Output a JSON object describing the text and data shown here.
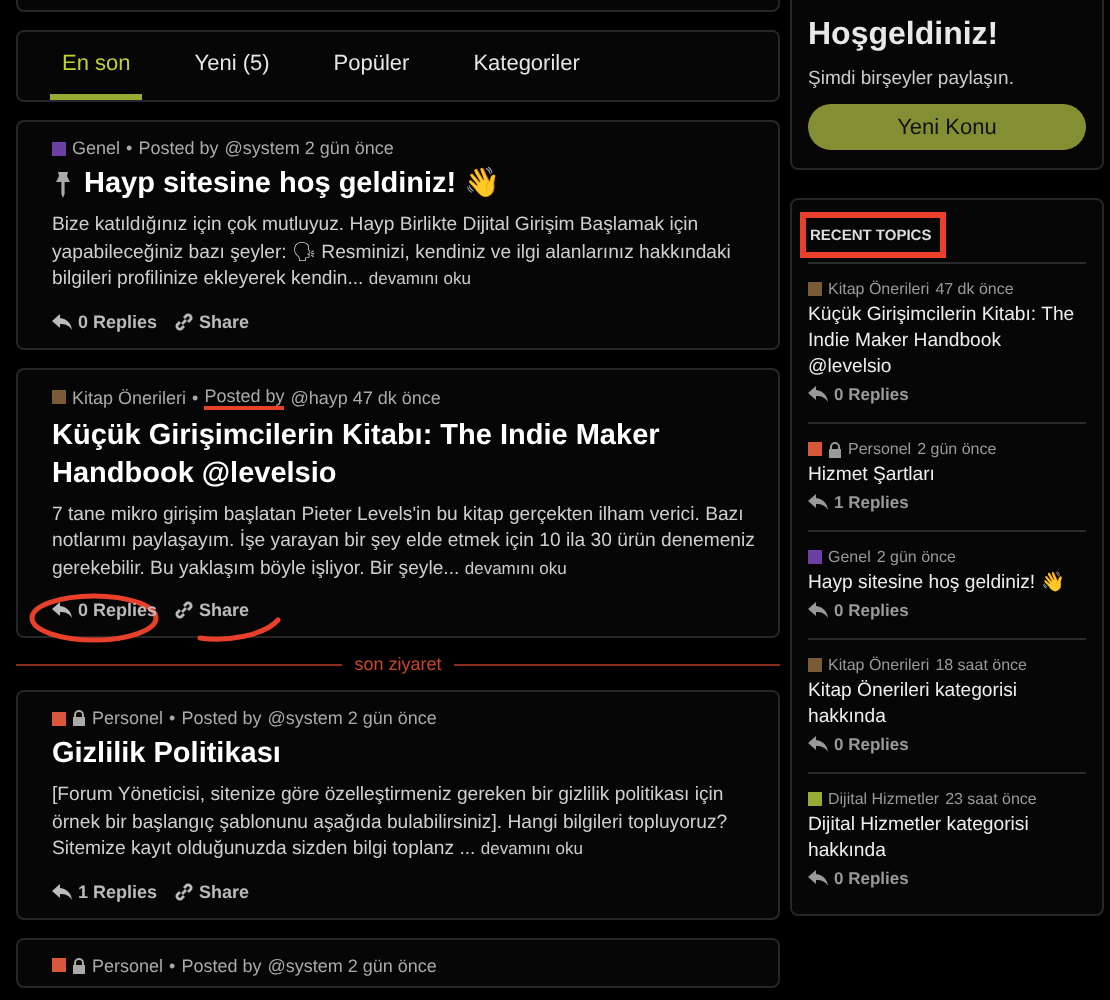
{
  "welcome": {
    "title": "Hoşgeldiniz!",
    "subtitle": "Şimdi birşeyler paylaşın.",
    "button": "Yeni Konu"
  },
  "tabs": [
    {
      "label": "En son",
      "selected": true
    },
    {
      "label": "Yeni (5)",
      "selected": false
    },
    {
      "label": "Popüler",
      "selected": false
    },
    {
      "label": "Kategoriler",
      "selected": false
    }
  ],
  "separator": "•",
  "posts": [
    {
      "category": "Genel",
      "color": "#6b3fa3",
      "locked": false,
      "posted_by": "Posted by",
      "byline": "@system 2 gün önce",
      "posted_by_underlined": false,
      "pinned": true,
      "title": "Hayp sitesine hoş geldiniz! 👋",
      "excerpt": "Bize katıldığınız için çok mutluyuz. Hayp Birlikte Dijital Girişim Başlamak için yapabileceğiniz bazı şeyler: 🗣 Resminizi, kendiniz ve ilgi alanlarınız hakkındaki bilgileri profilinize ekleyerek kendin...",
      "more": "devamını oku",
      "replies": "0 Replies",
      "replies_circled": false,
      "share": "Share",
      "share_underlined": false
    },
    {
      "category": "Kitap Önerileri",
      "color": "#7b5a36",
      "locked": false,
      "posted_by": "Posted by",
      "byline": "@hayp 47 dk önce",
      "posted_by_underlined": true,
      "pinned": false,
      "title": "Küçük Girişimcilerin Kitabı: The Indie Maker Handbook @levelsio",
      "excerpt": "7 tane mikro girişim başlatan Pieter Levels'in bu kitap gerçekten ilham verici. Bazı notlarımı paylaşayım. İşe yarayan bir şey elde etmek için 10 ila 30 ürün denemeniz gerekebilir. Bu yaklaşım böyle işliyor. Bir şeyle...",
      "more": "devamını oku",
      "replies": "0 Replies",
      "replies_circled": true,
      "share": "Share",
      "share_underlined": true,
      "divider_after": "son ziyaret"
    },
    {
      "category": "Personel",
      "color": "#d9573b",
      "locked": true,
      "posted_by": "Posted by",
      "byline": "@system 2 gün önce",
      "posted_by_underlined": false,
      "pinned": false,
      "title": "Gizlilik Politikası",
      "excerpt": "[Forum Yöneticisi, sitenize göre özelleştirmeniz gereken bir gizlilik politikası için örnek bir başlangıç şablonunu aşağıda bulabilirsiniz]. Hangi bilgileri topluyoruz? Sitemize kayıt olduğunuzda sizden bilgi toplanz ...",
      "more": "devamını oku",
      "replies": "1 Replies",
      "replies_circled": false,
      "share": "Share",
      "share_underlined": false
    },
    {
      "category": "Personel",
      "color": "#d9573b",
      "locked": true,
      "posted_by": "Posted by",
      "byline": "@system 2 gün önce",
      "posted_by_underlined": false,
      "pinned": false
    }
  ],
  "recent_topics": {
    "heading": "RECENT TOPICS",
    "heading_boxed": true,
    "items": [
      {
        "category": "Kitap Önerileri",
        "color": "#7b5a36",
        "locked": false,
        "time": "47 dk önce",
        "title": "Küçük Girişimcilerin Kitabı: The Indie Maker Handbook @levelsio",
        "replies": "0 Replies"
      },
      {
        "category": "Personel",
        "color": "#d9573b",
        "locked": true,
        "time": "2 gün önce",
        "title": "Hizmet Şartları",
        "replies": "1 Replies"
      },
      {
        "category": "Genel",
        "color": "#6b3fa3",
        "locked": false,
        "time": "2 gün önce",
        "title": "Hayp sitesine hoş geldiniz! 👋",
        "replies": "0 Replies"
      },
      {
        "category": "Kitap Önerileri",
        "color": "#7b5a36",
        "locked": false,
        "time": "18 saat önce",
        "title": "Kitap Önerileri kategorisi hakkında",
        "replies": "0 Replies"
      },
      {
        "category": "Dijital Hizmetler",
        "color": "#9aab35",
        "locked": false,
        "time": "23 saat önce",
        "title": "Dijital Hizmetler kategorisi hakkında",
        "replies": "0 Replies"
      }
    ]
  }
}
